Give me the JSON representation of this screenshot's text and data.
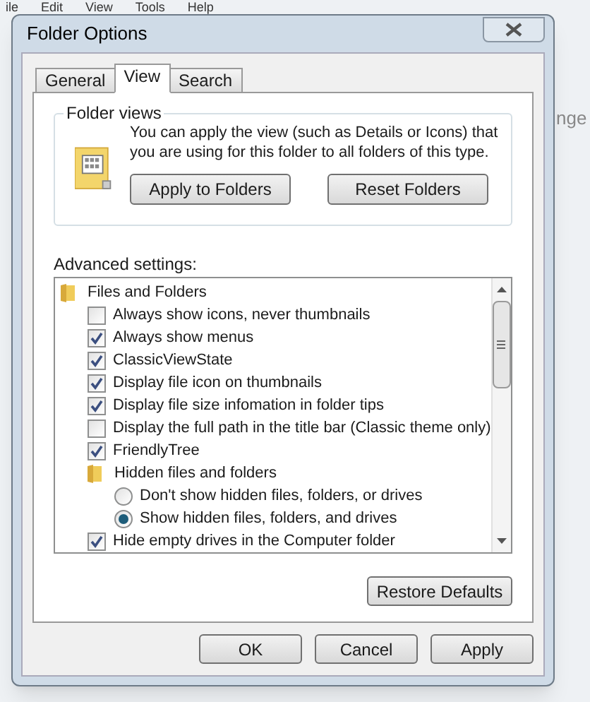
{
  "background_menu": [
    "ile",
    "Edit",
    "View",
    "Tools",
    "Help"
  ],
  "background_text": "nge",
  "window": {
    "title": "Folder Options"
  },
  "tabs": [
    {
      "label": "General",
      "selected": false
    },
    {
      "label": "View",
      "selected": true
    },
    {
      "label": "Search",
      "selected": false
    }
  ],
  "folder_views": {
    "title": "Folder views",
    "description": "You can apply the view (such as Details or Icons) that you are using for this folder to all folders of this type.",
    "buttons": [
      "Apply to Folders",
      "Reset Folders"
    ]
  },
  "advanced_settings": {
    "label": "Advanced settings:",
    "items": [
      {
        "kind": "folder",
        "label": "Files and Folders",
        "children": [
          {
            "kind": "checkbox",
            "label": "Always show icons, never thumbnails",
            "checked": false
          },
          {
            "kind": "checkbox",
            "label": "Always show menus",
            "checked": true
          },
          {
            "kind": "checkbox",
            "label": "ClassicViewState",
            "checked": true
          },
          {
            "kind": "checkbox",
            "label": "Display file icon on thumbnails",
            "checked": true
          },
          {
            "kind": "checkbox",
            "label": "Display file size infomation in folder tips",
            "checked": true
          },
          {
            "kind": "checkbox",
            "label": "Display the full path in the title bar (Classic theme only)",
            "checked": false
          },
          {
            "kind": "checkbox",
            "label": "FriendlyTree",
            "checked": true
          },
          {
            "kind": "folder",
            "label": "Hidden files and folders",
            "children": [
              {
                "kind": "radio",
                "label": "Don't show hidden files, folders, or drives",
                "selected": false
              },
              {
                "kind": "radio",
                "label": "Show hidden files, folders, and drives",
                "selected": true
              }
            ]
          },
          {
            "kind": "checkbox",
            "label": "Hide empty drives in the Computer folder",
            "checked": true
          }
        ]
      }
    ]
  },
  "restore_button": "Restore Defaults",
  "buttons": [
    "OK",
    "Cancel",
    "Apply"
  ]
}
